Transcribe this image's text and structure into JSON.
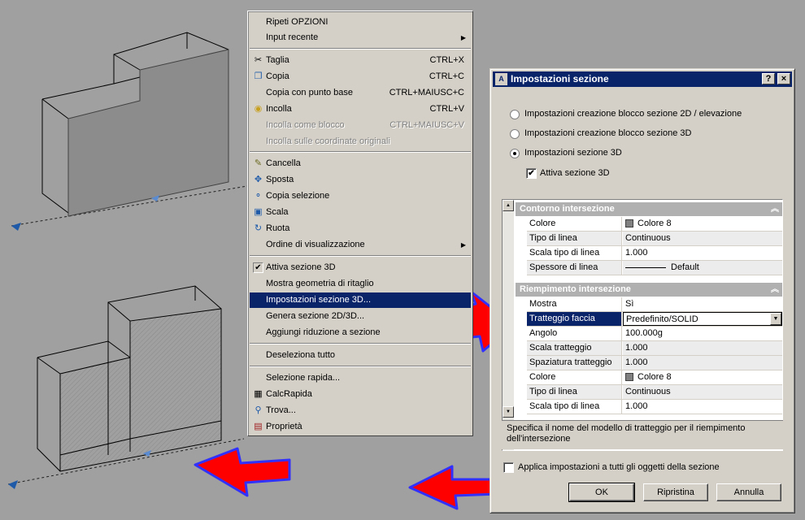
{
  "menu": {
    "items": [
      {
        "label": "Ripeti OPZIONI",
        "shortcut": "",
        "icon": "",
        "state": "normal",
        "submenu": false
      },
      {
        "label": "Input recente",
        "shortcut": "",
        "icon": "",
        "state": "normal",
        "submenu": true
      },
      {
        "label": "Taglia",
        "shortcut": "CTRL+X",
        "icon": "scissors-icon",
        "state": "normal",
        "submenu": false
      },
      {
        "label": "Copia",
        "shortcut": "CTRL+C",
        "icon": "copy-icon",
        "state": "normal",
        "submenu": false
      },
      {
        "label": "Copia con punto base",
        "shortcut": "CTRL+MAIUSC+C",
        "icon": "",
        "state": "normal",
        "submenu": false
      },
      {
        "label": "Incolla",
        "shortcut": "CTRL+V",
        "icon": "paste-icon",
        "state": "normal",
        "submenu": false
      },
      {
        "label": "Incolla come blocco",
        "shortcut": "CTRL+MAIUSC+V",
        "icon": "",
        "state": "disabled",
        "submenu": false
      },
      {
        "label": "Incolla sulle coordinate originali",
        "shortcut": "",
        "icon": "",
        "state": "disabled",
        "submenu": false
      },
      {
        "label": "Cancella",
        "shortcut": "",
        "icon": "eraser-icon",
        "state": "normal",
        "submenu": false
      },
      {
        "label": "Sposta",
        "shortcut": "",
        "icon": "move-icon",
        "state": "normal",
        "submenu": false
      },
      {
        "label": "Copia selezione",
        "shortcut": "",
        "icon": "copy-selection-icon",
        "state": "normal",
        "submenu": false
      },
      {
        "label": "Scala",
        "shortcut": "",
        "icon": "scale-icon",
        "state": "normal",
        "submenu": false
      },
      {
        "label": "Ruota",
        "shortcut": "",
        "icon": "rotate-icon",
        "state": "normal",
        "submenu": false
      },
      {
        "label": "Ordine di visualizzazione",
        "shortcut": "",
        "icon": "",
        "state": "normal",
        "submenu": true
      },
      {
        "label": "Attiva sezione 3D",
        "shortcut": "",
        "icon": "checkmark-icon",
        "state": "checked",
        "submenu": false
      },
      {
        "label": "Mostra geometria di ritaglio",
        "shortcut": "",
        "icon": "",
        "state": "normal",
        "submenu": false
      },
      {
        "label": "Impostazioni sezione 3D...",
        "shortcut": "",
        "icon": "",
        "state": "selected",
        "submenu": false
      },
      {
        "label": "Genera sezione 2D/3D...",
        "shortcut": "",
        "icon": "",
        "state": "normal",
        "submenu": false
      },
      {
        "label": "Aggiungi riduzione a sezione",
        "shortcut": "",
        "icon": "",
        "state": "normal",
        "submenu": false
      },
      {
        "label": "Deseleziona tutto",
        "shortcut": "",
        "icon": "",
        "state": "normal",
        "submenu": false
      },
      {
        "label": "Selezione rapida...",
        "shortcut": "",
        "icon": "",
        "state": "normal",
        "submenu": false
      },
      {
        "label": "CalcRapida",
        "shortcut": "",
        "icon": "calculator-icon",
        "state": "normal",
        "submenu": false
      },
      {
        "label": "Trova...",
        "shortcut": "",
        "icon": "find-icon",
        "state": "normal",
        "submenu": false
      },
      {
        "label": "Proprietà",
        "shortcut": "",
        "icon": "properties-icon",
        "state": "normal",
        "submenu": false
      }
    ]
  },
  "dialog": {
    "title": "Impostazioni sezione",
    "help_label": "?",
    "close_label": "×",
    "radios": [
      {
        "label": "Impostazioni creazione blocco sezione 2D / elevazione",
        "selected": false
      },
      {
        "label": "Impostazioni creazione blocco sezione 3D",
        "selected": false
      },
      {
        "label": "Impostazioni sezione 3D",
        "selected": true
      }
    ],
    "activate_checkbox": {
      "label": "Attiva sezione 3D",
      "checked": true
    },
    "categories": [
      {
        "title": "Contorno intersezione",
        "rows": [
          {
            "key": "Colore",
            "value": "Colore 8",
            "swatch": "#808080"
          },
          {
            "key": "Tipo di linea",
            "value": "Continuous"
          },
          {
            "key": "Scala tipo di linea",
            "value": "1.000"
          },
          {
            "key": "Spessore di linea",
            "value": "Default",
            "lineweight": true
          }
        ]
      },
      {
        "title": "Riempimento intersezione",
        "rows": [
          {
            "key": "Mostra",
            "value": "Sì"
          },
          {
            "key": "Tratteggio faccia",
            "value": "Predefinito/SOLID",
            "highlight": true
          },
          {
            "key": "Angolo",
            "value": "100.000g"
          },
          {
            "key": "Scala tratteggio",
            "value": "1.000"
          },
          {
            "key": "Spaziatura tratteggio",
            "value": "1.000"
          },
          {
            "key": "Colore",
            "value": "Colore 8",
            "swatch": "#808080"
          },
          {
            "key": "Tipo di linea",
            "value": "Continuous"
          },
          {
            "key": "Scala tipo di linea",
            "value": "1.000"
          }
        ]
      }
    ],
    "description": "Specifica il nome del modello di tratteggio per il riempimento dell'intersezione",
    "apply_all_checkbox": {
      "label": "Applica impostazioni a tutti gli oggetti della sezione",
      "checked": false
    },
    "buttons": {
      "ok": "OK",
      "reset": "Ripristina",
      "cancel": "Annulla"
    }
  },
  "colors": {
    "background": "#a0a0a0",
    "selection": "#0a246a",
    "arrow_fill": "#ff0000",
    "arrow_stroke": "#3030ff",
    "solid_fill": "#8c8c8c"
  }
}
